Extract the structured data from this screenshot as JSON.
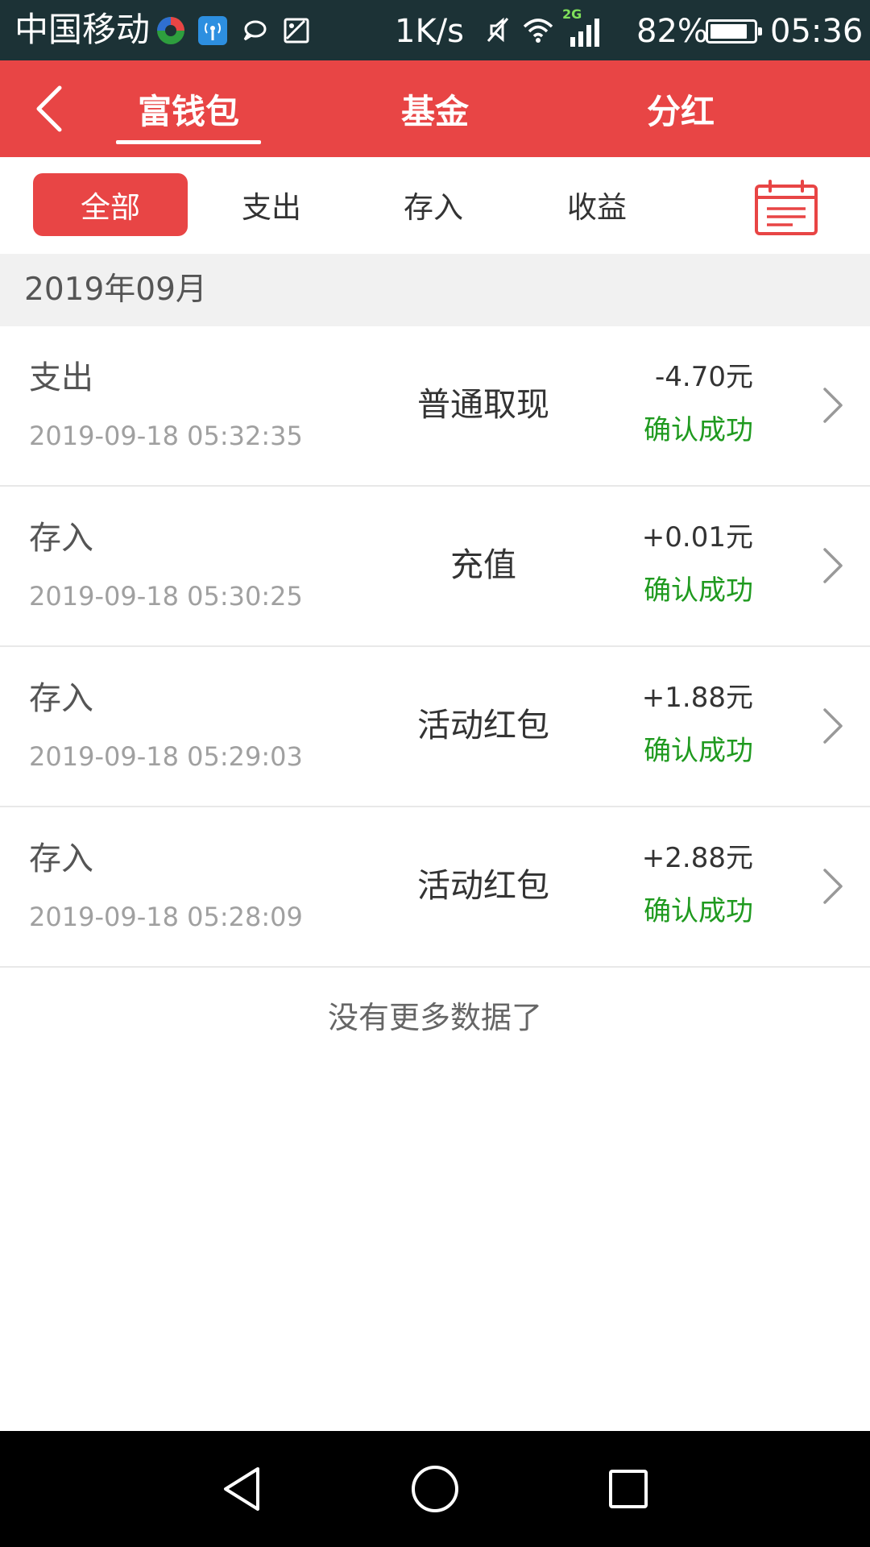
{
  "status_bar": {
    "carrier": "中国移动",
    "network_speed": "1K/s",
    "signal_type": "2G",
    "battery_percent": "82%",
    "time": "05:36",
    "icons": [
      "app-icon",
      "wifi-hotspot-icon",
      "message-icon",
      "image-icon",
      "mute-icon",
      "wifi-icon",
      "signal-icon",
      "battery-icon"
    ]
  },
  "header": {
    "tabs": [
      {
        "label": "富钱包",
        "active": true
      },
      {
        "label": "基金",
        "active": false
      },
      {
        "label": "分红",
        "active": false
      }
    ],
    "accent_color": "#e84545"
  },
  "filters": {
    "items": [
      {
        "label": "全部",
        "active": true
      },
      {
        "label": "支出",
        "active": false
      },
      {
        "label": "存入",
        "active": false
      },
      {
        "label": "收益",
        "active": false
      }
    ]
  },
  "month": "2019年09月",
  "records": [
    {
      "kind": "支出",
      "time": "2019-09-18 05:32:35",
      "desc": "普通取现",
      "amount": "-4.70元",
      "status": "确认成功"
    },
    {
      "kind": "存入",
      "time": "2019-09-18 05:30:25",
      "desc": "充值",
      "amount": "+0.01元",
      "status": "确认成功"
    },
    {
      "kind": "存入",
      "time": "2019-09-18 05:29:03",
      "desc": "活动红包",
      "amount": "+1.88元",
      "status": "确认成功"
    },
    {
      "kind": "存入",
      "time": "2019-09-18 05:28:09",
      "desc": "活动红包",
      "amount": "+2.88元",
      "status": "确认成功"
    }
  ],
  "no_more_text": "没有更多数据了",
  "status_color": "#1f9a1f"
}
